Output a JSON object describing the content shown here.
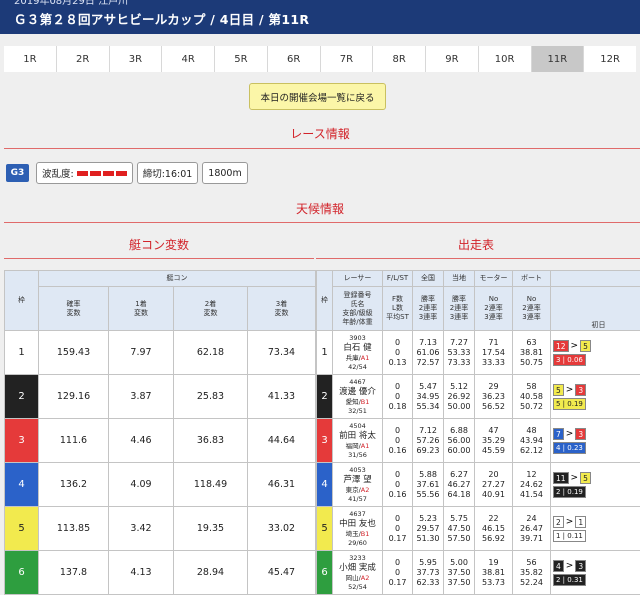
{
  "header": {
    "date": "2019年08月29日 江戸川",
    "title": "Ｇ３第２８回アサヒビールカップ / 4日目 / 第11R"
  },
  "race_tabs": [
    "1R",
    "2R",
    "3R",
    "4R",
    "5R",
    "6R",
    "7R",
    "8R",
    "9R",
    "10R",
    "11R",
    "12R"
  ],
  "active_tab": "11R",
  "back_button": "本日の開催会場一覧に戻る",
  "sections": {
    "race_info": "レース情報",
    "weather": "天候情報",
    "boat_con": "艇コン変数",
    "entries": "出走表"
  },
  "race_info": {
    "grade": "G3",
    "turbulence_label": "波乱度:",
    "turbulence_level": 4,
    "deadline": "締切:16:01",
    "distance": "1800m"
  },
  "colors": {
    "accent": "#d2232a",
    "header_bg": "#1c3a78",
    "frame1": "#ffffff",
    "frame2": "#222222",
    "frame3": "#e53a3a",
    "frame4": "#2b62c9",
    "frame5": "#f2ea4e",
    "frame6": "#2e9e3f"
  },
  "boat_con_table": {
    "group_header": "艇コン",
    "frame_header": "枠",
    "columns": [
      "確率\n変数",
      "1着\n変数",
      "2着\n変数",
      "3着\n変数"
    ],
    "rows": [
      {
        "frame": "1",
        "v": [
          "159.43",
          "7.97",
          "62.18",
          "73.34"
        ]
      },
      {
        "frame": "2",
        "v": [
          "129.16",
          "3.87",
          "25.83",
          "41.33"
        ]
      },
      {
        "frame": "3",
        "v": [
          "111.6",
          "4.46",
          "36.83",
          "44.64"
        ]
      },
      {
        "frame": "4",
        "v": [
          "136.2",
          "4.09",
          "118.49",
          "46.31"
        ]
      },
      {
        "frame": "5",
        "v": [
          "113.85",
          "3.42",
          "19.35",
          "33.02"
        ]
      },
      {
        "frame": "6",
        "v": [
          "137.8",
          "4.13",
          "28.94",
          "45.47"
        ]
      }
    ]
  },
  "entry_table": {
    "frame_header": "枠",
    "headers": [
      "レーサー",
      "F/L/ST",
      "全国",
      "当地",
      "モーター",
      "ボート"
    ],
    "sub_headers": [
      "登録番号\n氏名\n支部/級級\n年齢/体重",
      "F数\nL数\n平均ST",
      "勝率\n2連率\n3連率",
      "勝率\n2連率\n3連率",
      "No\n2連率\n3連率",
      "No\n2連率\n3連率"
    ],
    "day_header": "初日",
    "rows": [
      {
        "frame": "1",
        "reg": "3903",
        "name": "白石 健",
        "branch": "兵庫",
        "cls": "A1",
        "age": "42/54",
        "fl": [
          "0",
          "0",
          "0.13"
        ],
        "nat": [
          "7.13",
          "61.06",
          "72.57"
        ],
        "loc": [
          "7.27",
          "53.33",
          "73.33"
        ],
        "motor": [
          "71",
          "17.54",
          "33.33"
        ],
        "boat": [
          "63",
          "38.81",
          "50.75"
        ],
        "d1": {
          "a": "12",
          "ac": "f3",
          "b": "5",
          "bc": "f5",
          "s": "3 | 0.06",
          "sc": "f3"
        }
      },
      {
        "frame": "2",
        "reg": "4467",
        "name": "渡邊 優介",
        "branch": "愛知",
        "cls": "B1",
        "age": "32/51",
        "fl": [
          "0",
          "0",
          "0.18"
        ],
        "nat": [
          "5.47",
          "34.95",
          "55.34"
        ],
        "loc": [
          "5.12",
          "26.92",
          "50.00"
        ],
        "motor": [
          "29",
          "36.23",
          "56.52"
        ],
        "boat": [
          "58",
          "40.58",
          "50.72"
        ],
        "d1": {
          "a": "5",
          "ac": "f5",
          "b": "3",
          "bc": "f3",
          "s": "5 | 0.19",
          "sc": "f5"
        }
      },
      {
        "frame": "3",
        "reg": "4504",
        "name": "前田 将太",
        "branch": "福岡",
        "cls": "A1",
        "age": "31/56",
        "fl": [
          "0",
          "0",
          "0.16"
        ],
        "nat": [
          "7.12",
          "57.26",
          "69.23"
        ],
        "loc": [
          "6.88",
          "56.00",
          "60.00"
        ],
        "motor": [
          "47",
          "35.29",
          "45.59"
        ],
        "boat": [
          "48",
          "43.94",
          "62.12"
        ],
        "d1": {
          "a": "7",
          "ac": "f4",
          "b": "3",
          "bc": "f3",
          "s": "4 | 0.23",
          "sc": "f4"
        }
      },
      {
        "frame": "4",
        "reg": "4053",
        "name": "芦澤 望",
        "branch": "東京",
        "cls": "A2",
        "age": "41/57",
        "fl": [
          "0",
          "0",
          "0.16"
        ],
        "nat": [
          "5.88",
          "37.61",
          "55.56"
        ],
        "loc": [
          "6.27",
          "46.27",
          "64.18"
        ],
        "motor": [
          "20",
          "27.27",
          "40.91"
        ],
        "boat": [
          "12",
          "24.62",
          "41.54"
        ],
        "d1": {
          "a": "11",
          "ac": "f2",
          "b": "5",
          "bc": "f5",
          "s": "2 | 0.19",
          "sc": "f2"
        }
      },
      {
        "frame": "5",
        "reg": "4637",
        "name": "中田 友也",
        "branch": "埼玉",
        "cls": "B1",
        "age": "29/60",
        "fl": [
          "0",
          "0",
          "0.17"
        ],
        "nat": [
          "5.23",
          "29.57",
          "51.30"
        ],
        "loc": [
          "5.75",
          "47.50",
          "57.50"
        ],
        "motor": [
          "22",
          "46.15",
          "56.92"
        ],
        "boat": [
          "24",
          "26.47",
          "39.71"
        ],
        "d1": {
          "a": "2",
          "ac": "f1",
          "b": "1",
          "bc": "f1",
          "s": "1 | 0.11",
          "sc": "f1"
        }
      },
      {
        "frame": "6",
        "reg": "3233",
        "name": "小畑 実成",
        "branch": "岡山",
        "cls": "A2",
        "age": "52/54",
        "fl": [
          "0",
          "0",
          "0.17"
        ],
        "nat": [
          "5.95",
          "37.73",
          "62.33"
        ],
        "loc": [
          "5.00",
          "37.50",
          "37.50"
        ],
        "motor": [
          "19",
          "38.81",
          "53.73"
        ],
        "boat": [
          "56",
          "35.82",
          "52.24"
        ],
        "d1": {
          "a": "4",
          "ac": "f2",
          "b": "3",
          "bc": "f2",
          "s": "2 | 0.31",
          "sc": "f2"
        }
      }
    ]
  }
}
